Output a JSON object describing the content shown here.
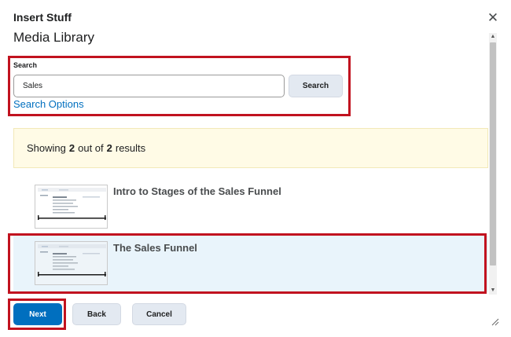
{
  "dialog": {
    "title": "Insert Stuff",
    "close_icon": "close-icon"
  },
  "page": {
    "heading": "Media Library"
  },
  "search": {
    "label": "Search",
    "value": "Sales",
    "button_label": "Search",
    "options_link": "Search Options"
  },
  "results": {
    "prefix": "Showing",
    "shown": "2",
    "middle": "out of",
    "total": "2",
    "suffix": "results",
    "items": [
      {
        "title": "Intro to Stages of the Sales Funnel",
        "selected": false
      },
      {
        "title": "The Sales Funnel",
        "selected": true
      }
    ]
  },
  "footer": {
    "next_label": "Next",
    "back_label": "Back",
    "cancel_label": "Cancel"
  },
  "colors": {
    "primary": "#006fbf",
    "highlight_outline": "#c1121f",
    "banner_bg": "#fffbe6",
    "selected_bg": "#e9f4fb"
  }
}
